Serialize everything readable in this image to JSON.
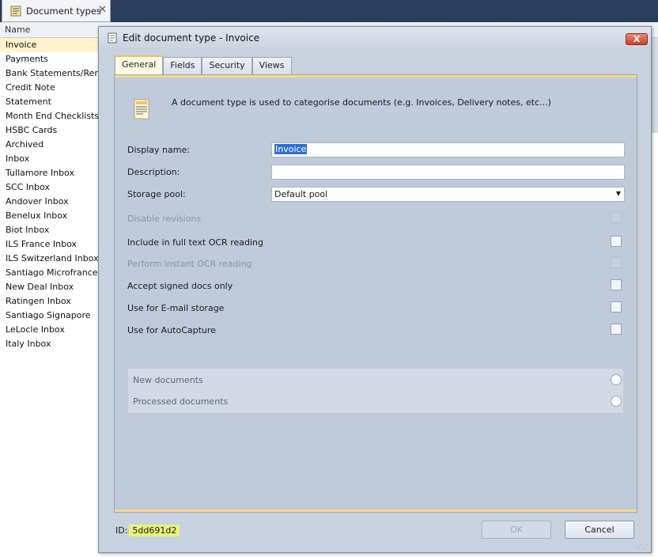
{
  "doc_tab": {
    "title": "Document types",
    "close": "✕"
  },
  "list": {
    "header": "Name",
    "items": [
      "Invoice",
      "Payments",
      "Bank Statements/Remitt",
      "Credit Note",
      "Statement",
      "Month End Checklists",
      "HSBC Cards",
      "Archived",
      "Inbox",
      "Tullamore Inbox",
      "SCC Inbox",
      "Andover Inbox",
      "Benelux Inbox",
      "Biot Inbox",
      "ILS France Inbox",
      "ILS Switzerland Inbox",
      "Santiago Microfrance",
      "New Deal Inbox",
      "Ratingen Inbox",
      "Santiago Signapore",
      "LeLocle Inbox",
      "Italy Inbox"
    ],
    "selected_index": 0
  },
  "dialog": {
    "title": "Edit document type - Invoice",
    "close_label": "X",
    "tabs": [
      "General",
      "Fields",
      "Security",
      "Views"
    ],
    "active_tab": "General",
    "info_text": "A document type is used to categorise documents (e.g. Invoices, Delivery notes, etc...)",
    "fields": {
      "display_name_label": "Display name:",
      "display_name_value": "Invoice",
      "description_label": "Description:",
      "description_value": "",
      "storage_pool_label": "Storage pool:",
      "storage_pool_value": "Default pool"
    },
    "options": {
      "disable_revisions": "Disable revisions",
      "full_text_ocr": "Include in full text OCR reading",
      "instant_ocr": "Perform instant OCR reading",
      "signed_docs": "Accept signed docs only",
      "email_storage": "Use for E-mail storage",
      "autocapture": "Use for AutoCapture"
    },
    "group": {
      "new_documents": "New documents",
      "processed_documents": "Processed documents"
    },
    "id_label": "ID:",
    "id_value": "5dd691d2",
    "ok_label": "OK",
    "cancel_label": "Cancel"
  },
  "colors": {
    "topbar": "#2b3d5c",
    "dialog_bg": "#c8d1de",
    "content_bg": "#bfcadb",
    "accent_tab": "#f2c44e",
    "selection": "#3270d6",
    "id_highlight": "#e6f27a",
    "close_button": "#c8422a"
  },
  "icons": {
    "doc_tab": "document-list-icon",
    "dialog": "document-icon",
    "info": "document-large-icon",
    "dropdown": "triangle-down-icon"
  }
}
